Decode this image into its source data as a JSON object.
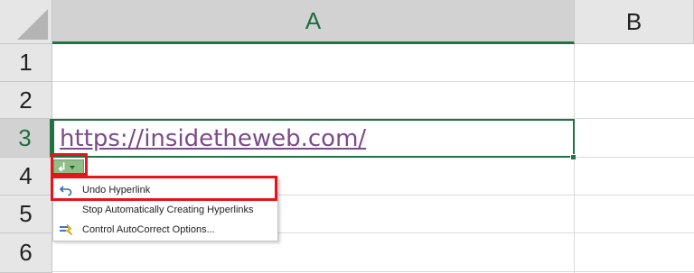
{
  "columns": [
    {
      "label": "A",
      "selected": true
    },
    {
      "label": "B",
      "selected": false
    }
  ],
  "rows": [
    {
      "label": "1",
      "selected": false
    },
    {
      "label": "2",
      "selected": false
    },
    {
      "label": "3",
      "selected": true
    },
    {
      "label": "4",
      "selected": false
    },
    {
      "label": "5",
      "selected": false
    },
    {
      "label": "6",
      "selected": false
    }
  ],
  "active_cell": {
    "ref": "A3",
    "value": "https://insidetheweb.com/"
  },
  "smart_tag": {
    "icon": "autocorrect-options-icon"
  },
  "menu": {
    "items": [
      {
        "label": "Undo Hyperlink",
        "icon": "undo-icon",
        "accelerator": "U"
      },
      {
        "label": "Stop Automatically Creating Hyperlinks",
        "icon": "none",
        "accelerator": "S"
      },
      {
        "label": "Control AutoCorrect Options...",
        "icon": "autocorrect-icon",
        "accelerator": "C"
      }
    ]
  },
  "colors": {
    "header_bg": "#e6e6e6",
    "selected_header_bg": "#d2d2d2",
    "accent_green": "#217346",
    "hyperlink": "#7b4b8a",
    "highlight_red": "#e8141c",
    "grid": "#dadada"
  }
}
